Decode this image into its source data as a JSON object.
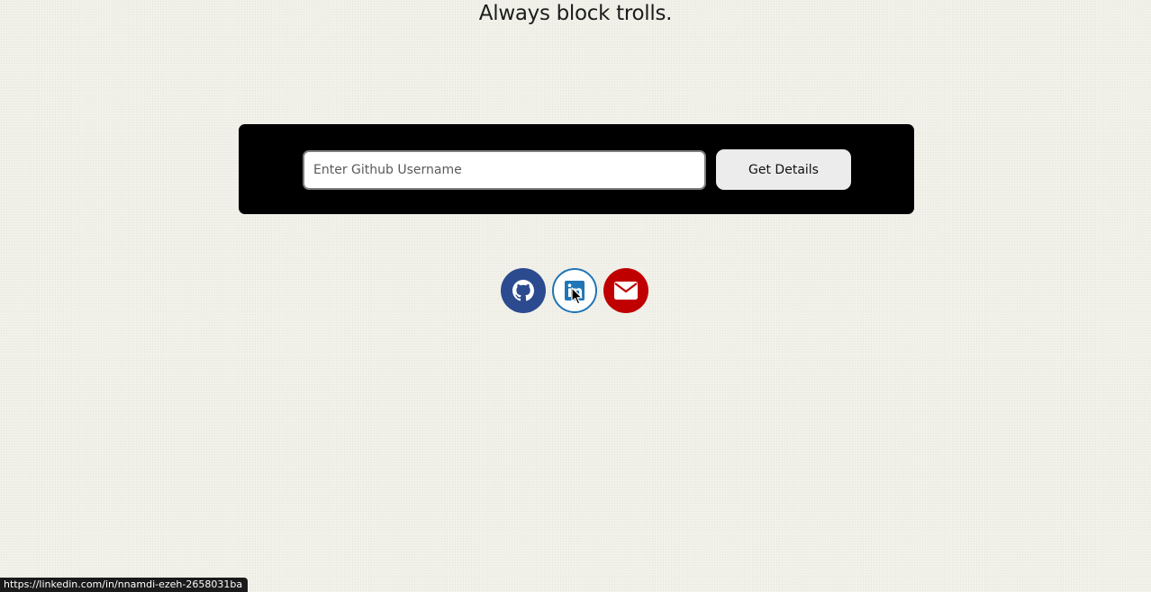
{
  "tagline": "Always block trolls.",
  "search": {
    "placeholder": "Enter Github Username",
    "value": "",
    "button_label": "Get Details"
  },
  "social": {
    "items": [
      {
        "name": "github",
        "icon": "github-icon",
        "color": "#2c4a8f"
      },
      {
        "name": "linkedin",
        "icon": "linkedin-icon",
        "color": "#1f75b5"
      },
      {
        "name": "email",
        "icon": "envelope-icon",
        "color": "#c00000"
      }
    ]
  },
  "status_bar": {
    "url": "https://linkedin.com/in/nnamdi-ezeh-2658031ba"
  },
  "colors": {
    "panel": "#000000",
    "page_background": "#f1f1ea"
  }
}
